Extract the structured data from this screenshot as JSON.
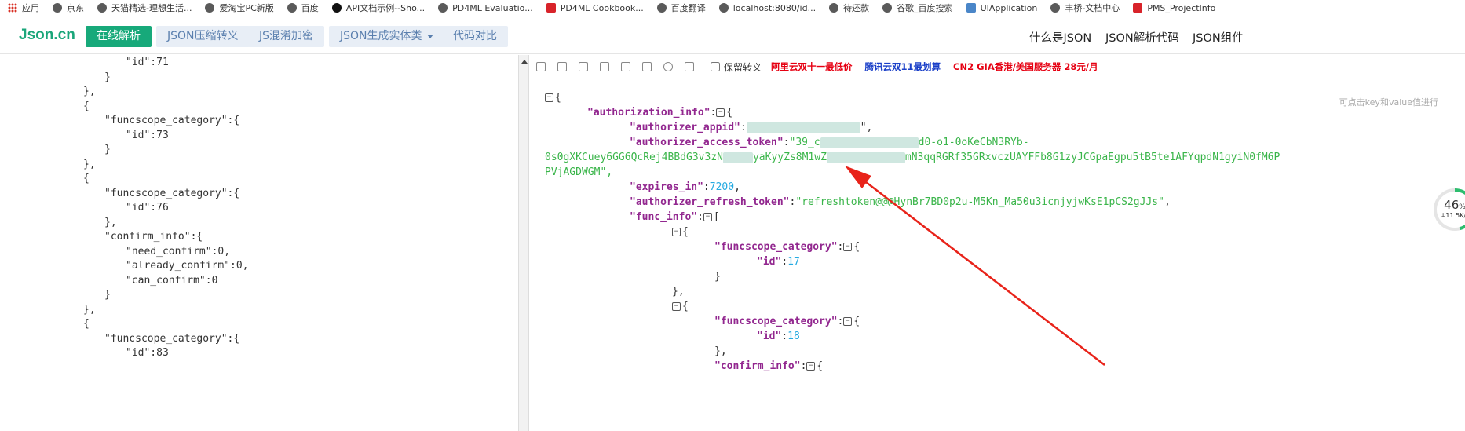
{
  "bookmarks": [
    {
      "label": "应用",
      "icon": "apps-icon"
    },
    {
      "label": "京东",
      "icon": "globe-icon"
    },
    {
      "label": "天猫精选-理想生活...",
      "icon": "globe-icon"
    },
    {
      "label": "爱淘宝PC新版",
      "icon": "globe-icon"
    },
    {
      "label": "百度",
      "icon": "globe-icon"
    },
    {
      "label": "API文档示例--Sho...",
      "icon": "api-icon"
    },
    {
      "label": "PD4ML Evaluatio...",
      "icon": "document-icon"
    },
    {
      "label": "PD4ML Cookbook...",
      "icon": "pd4ml-icon"
    },
    {
      "label": "百度翻译",
      "icon": "globe-icon"
    },
    {
      "label": "localhost:8080/id...",
      "icon": "globe-icon"
    },
    {
      "label": "待还款",
      "icon": "globe-icon"
    },
    {
      "label": "谷歌_百度搜索",
      "icon": "globe-icon"
    },
    {
      "label": "UIApplication",
      "icon": "apple-doc-icon"
    },
    {
      "label": "丰桥-文档中心",
      "icon": "globe-icon"
    },
    {
      "label": "PMS_ProjectInfo",
      "icon": "pms-icon"
    }
  ],
  "header": {
    "logo_main": "Json",
    "logo_cn": ".cn",
    "nav": [
      {
        "label": "在线解析",
        "active": true
      },
      {
        "label": "JSON压缩转义"
      },
      {
        "label": "JS混淆加密"
      },
      {
        "label": "JSON生成实体类"
      },
      {
        "label": "代码对比"
      }
    ],
    "right_links": [
      "什么是JSON",
      "JSON解析代码",
      "JSON组件"
    ]
  },
  "toolbar": {
    "keep_escape_label": "保留转义",
    "ads": [
      {
        "text": "阿里云双十一最低价",
        "color": "#e60012"
      },
      {
        "text": "腾讯云双11最划算",
        "color": "#1a3fc8"
      },
      {
        "text": "CN2 GIA香港/美国服务器 28元/月",
        "color": "#e60012"
      }
    ]
  },
  "right_hint": "可点击key和value值进行",
  "left_lines": [
    {
      "i": 6,
      "t": "\"id\":71"
    },
    {
      "i": 5,
      "t": "}"
    },
    {
      "i": 4,
      "t": "},"
    },
    {
      "i": 4,
      "t": "{"
    },
    {
      "i": 5,
      "t": "\"funcscope_category\":{"
    },
    {
      "i": 6,
      "t": "\"id\":73"
    },
    {
      "i": 5,
      "t": "}"
    },
    {
      "i": 4,
      "t": "},"
    },
    {
      "i": 4,
      "t": "{"
    },
    {
      "i": 5,
      "t": "\"funcscope_category\":{"
    },
    {
      "i": 6,
      "t": "\"id\":76"
    },
    {
      "i": 5,
      "t": "},"
    },
    {
      "i": 5,
      "t": "\"confirm_info\":{"
    },
    {
      "i": 6,
      "t": "\"need_confirm\":0,"
    },
    {
      "i": 6,
      "t": "\"already_confirm\":0,"
    },
    {
      "i": 6,
      "t": "\"can_confirm\":0"
    },
    {
      "i": 5,
      "t": "}"
    },
    {
      "i": 4,
      "t": "},"
    },
    {
      "i": 4,
      "t": "{"
    },
    {
      "i": 5,
      "t": "\"funcscope_category\":{"
    },
    {
      "i": 6,
      "t": "\"id\":83"
    }
  ],
  "json": {
    "root_open": "{",
    "authorization_info_key": "\"authorization_info\"",
    "authorizer_appid_key": "\"authorizer_appid\"",
    "authorizer_appid_val_end": "\",",
    "authorizer_access_token_key": "\"authorizer_access_token\"",
    "access_token_part1": "\"39_c",
    "access_token_part2": "d0-o1-0oKeCbN3RYb-",
    "access_token_line2a": "0s0gXKCuey6GG6QcRej4BBdG3v3zN",
    "access_token_line2b": "yaKyyZs8M1wZ",
    "access_token_line2c": "mN3qqRGRf35GRxvczUAYFFb8G1zyJCGpaEgpu5tB5te1AFYqpdN1gyiN0fM6P",
    "access_token_line3": "PVjAGDWGM\",",
    "expires_in_key": "\"expires_in\"",
    "expires_in_val": "7200",
    "authorizer_refresh_token_key": "\"authorizer_refresh_token\"",
    "refresh_token_val": "\"refreshtoken@@@HynBr7BD0p2u-M5Kn_Ma50u3icnjyjwKsE1pCS2gJJs\"",
    "func_info_key": "\"func_info\"",
    "funcscope_category_key": "\"funcscope_category\"",
    "id_key": "\"id\"",
    "id_val_1": "17",
    "id_val_2": "18",
    "confirm_info_key": "\"confirm_info\""
  },
  "net_gauge": {
    "percent_text": "46",
    "percent_sign": "%",
    "speed": "↓11.5K/s",
    "percent_value": 46
  }
}
